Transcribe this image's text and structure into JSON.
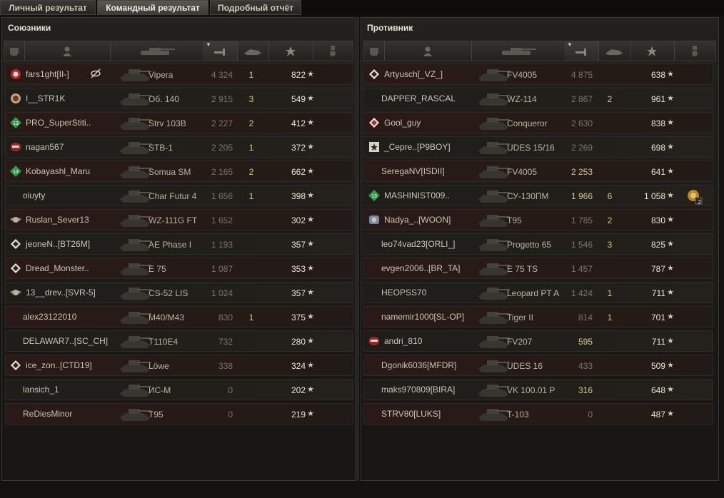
{
  "tabs": [
    "Личный результат",
    "Командный результат",
    "Подробный отчёт"
  ],
  "active_tab": 1,
  "allies_title": "Союзники",
  "enemies_title": "Противник",
  "allies": [
    {
      "name": "fars1ght[II-]",
      "tank": "Vipera",
      "dmg": "4 324",
      "kills": "1",
      "xp": "822",
      "badge": "red-circle-icon",
      "extra": "eye-off-icon"
    },
    {
      "name": "I__STR1K",
      "tank": "Об. 140",
      "dmg": "2 915",
      "kills": "3",
      "xp": "549",
      "badge": "bronze-circle-icon"
    },
    {
      "name": "PRO_SuperStiti..",
      "tank": "Strv 103B",
      "dmg": "2 227",
      "kills": "2",
      "xp": "412",
      "badge": "green-13-icon"
    },
    {
      "name": "nagan567",
      "tank": "STB-1",
      "dmg": "2 205",
      "kills": "1",
      "xp": "372",
      "badge": "red-stripe-icon"
    },
    {
      "name": "Kobayashl_Maru",
      "tank": "Somua SM",
      "dmg": "2 165",
      "kills": "2",
      "xp": "662",
      "badge": "green-13-icon"
    },
    {
      "name": "oiuyty",
      "tank": "Char Futur 4",
      "dmg": "1 656",
      "kills": "1",
      "xp": "398",
      "badge": ""
    },
    {
      "name": "Ruslan_Sever13",
      "tank": "WZ-111G FT",
      "dmg": "1 652",
      "kills": "",
      "xp": "302",
      "badge": "winged-emblem-icon"
    },
    {
      "name": "jeoneN..[BT26M]",
      "tank": "AE Phase I",
      "dmg": "1 193",
      "kills": "",
      "xp": "357",
      "badge": "diamond-icon"
    },
    {
      "name": "Dread_Monster..",
      "tank": "E 75",
      "dmg": "1 087",
      "kills": "",
      "xp": "353",
      "badge": "diamond-icon"
    },
    {
      "name": "13__drev..[SVR-5]",
      "tank": "CS-52 LIS",
      "dmg": "1 024",
      "kills": "",
      "xp": "357",
      "badge": "winged-emblem-icon"
    },
    {
      "name": "alex23122010",
      "tank": "M40/M43",
      "dmg": "830",
      "kills": "1",
      "xp": "375",
      "badge": ""
    },
    {
      "name": "DELAWAR7..[SC_CH]",
      "tank": "T110E4",
      "dmg": "732",
      "kills": "",
      "xp": "280",
      "badge": ""
    },
    {
      "name": "ice_zon..[CTD19]",
      "tank": "Löwe",
      "dmg": "338",
      "kills": "",
      "xp": "324",
      "badge": "diamond-icon"
    },
    {
      "name": "lansich_1",
      "tank": "ИС-М",
      "dmg": "0",
      "kills": "",
      "xp": "202",
      "badge": ""
    },
    {
      "name": "ReDiesMinor",
      "tank": "T95",
      "dmg": "0",
      "kills": "",
      "xp": "219",
      "badge": ""
    }
  ],
  "enemies": [
    {
      "name": "Artyusch[_VZ_]",
      "tank": "FV4005",
      "dmg": "4 875",
      "kills": "",
      "xp": "638",
      "badge": "diamond-icon"
    },
    {
      "name": "DAPPER_RASCAL",
      "tank": "WZ-114",
      "dmg": "2 867",
      "kills": "2",
      "xp": "961",
      "badge": ""
    },
    {
      "name": "Gool_guy",
      "tank": "Conqueror",
      "dmg": "2 630",
      "kills": "",
      "xp": "838",
      "badge": "red-diamond-icon"
    },
    {
      "name": "_Cepre..[P9BOY]",
      "tank": "UDES 15/16",
      "dmg": "2 269",
      "kills": "",
      "xp": "698",
      "badge": "star-shield-icon"
    },
    {
      "name": "SeregaNV[ISDII]",
      "tank": "FV4005",
      "dmg": "2 253",
      "kills": "",
      "xp": "641",
      "badge": "",
      "dmgHi": true
    },
    {
      "name": "MASHINIST009..",
      "tank": "СУ-130ПМ",
      "dmg": "1 966",
      "kills": "6",
      "xp": "1 058",
      "badge": "green-13-icon",
      "dmgHi": true,
      "medal": "2"
    },
    {
      "name": "Nadya_..[WOON]",
      "tank": "T95",
      "dmg": "1 785",
      "kills": "2",
      "xp": "830",
      "badge": "blue-emblem-icon"
    },
    {
      "name": "leo74vad23[ORLI_]",
      "tank": "Progetto 65",
      "dmg": "1 546",
      "kills": "3",
      "xp": "825",
      "badge": ""
    },
    {
      "name": "evgen2006..[BR_TA]",
      "tank": "E 75 TS",
      "dmg": "1 457",
      "kills": "",
      "xp": "787",
      "badge": ""
    },
    {
      "name": "HEOPSS70",
      "tank": "Leopard PT A",
      "dmg": "1 424",
      "kills": "1",
      "xp": "711",
      "badge": ""
    },
    {
      "name": "namemir1000[SL-OP]",
      "tank": "Tiger II",
      "dmg": "814",
      "kills": "1",
      "xp": "701",
      "badge": ""
    },
    {
      "name": "andri_810",
      "tank": "FV207",
      "dmg": "595",
      "kills": "",
      "xp": "711",
      "badge": "red-stripe-icon",
      "dmgHi": true
    },
    {
      "name": "Dgonik6036[MFDR]",
      "tank": "UDES 16",
      "dmg": "433",
      "kills": "",
      "xp": "509",
      "badge": ""
    },
    {
      "name": "maks970809[BIRA]",
      "tank": "VK 100.01 P",
      "dmg": "316",
      "kills": "",
      "xp": "648",
      "badge": "",
      "dmgHi": true
    },
    {
      "name": "STRV80[LUKS]",
      "tank": "T-103",
      "dmg": "0",
      "kills": "",
      "xp": "487",
      "badge": ""
    }
  ],
  "star_glyph": "★"
}
